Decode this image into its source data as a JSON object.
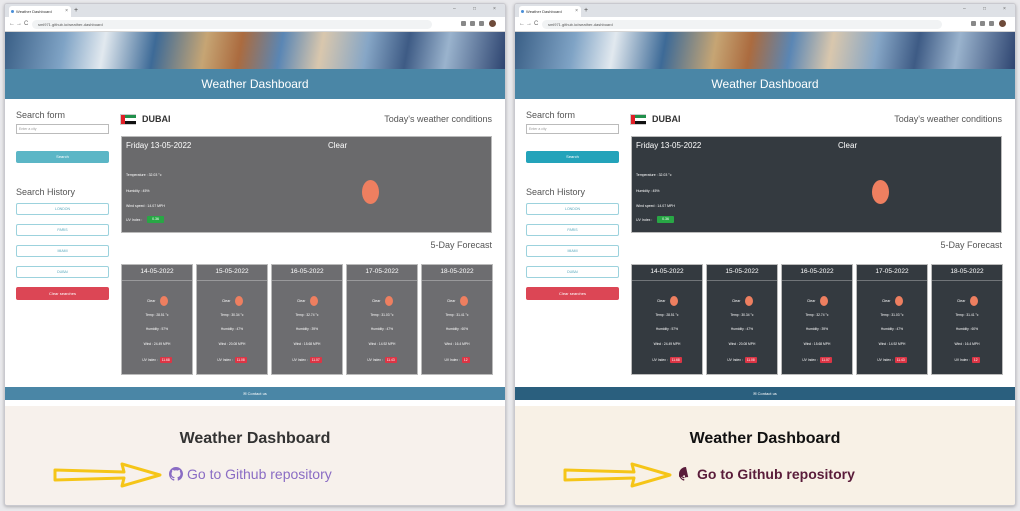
{
  "browser": {
    "tab_title": "Weather Dashboard",
    "new_tab": "+",
    "tab_close": "×",
    "url": "sml971.github.io/weather-dashboard",
    "back": "←",
    "forward": "→",
    "reload": "C",
    "window_controls": [
      "–",
      "□",
      "×"
    ]
  },
  "app": {
    "title": "Weather Dashboard",
    "search_form_title": "Search form",
    "search_placeholder": "Enter a city",
    "search_button": "Search",
    "history_title": "Search History",
    "history": [
      "LONDON",
      "PARIS",
      "MIAMI",
      "DUBAI"
    ],
    "clear_button": "Clear searches",
    "city": "DUBAI",
    "today_label": "Today's weather conditions",
    "current": {
      "date": "Friday 13-05-2022",
      "description": "Clear",
      "temperature": "Temperature : 32.03 °c",
      "humidity": "Humidity : 45%",
      "wind": "Wind speed : 14.07 MPH",
      "uv_label": "UV Index :",
      "uv_value": "0.36"
    },
    "forecast_label": "5-Day Forecast",
    "forecast": [
      {
        "date": "14-05-2022",
        "desc": "Clear",
        "temp": "Temp : 28.51 °c",
        "humidity": "Humidity : 57%",
        "wind": "Wind : 24.49 MPH",
        "uv_label": "UV Index :",
        "uv": "11.68"
      },
      {
        "date": "15-05-2022",
        "desc": "Clear",
        "temp": "Temp : 30.34 °c",
        "humidity": "Humidity : 47%",
        "wind": "Wind : 20.08 MPH",
        "uv_label": "UV Index :",
        "uv": "11.08"
      },
      {
        "date": "16-05-2022",
        "desc": "Clear",
        "temp": "Temp : 32.74 °c",
        "humidity": "Humidity : 39%",
        "wind": "Wind : 15.68 MPH",
        "uv_label": "UV Index :",
        "uv": "11.07"
      },
      {
        "date": "17-05-2022",
        "desc": "Clear",
        "temp": "Temp : 31.03 °c",
        "humidity": "Humidity : 47%",
        "wind": "Wind : 14.92 MPH",
        "uv_label": "UV Index :",
        "uv": "11.43"
      },
      {
        "date": "18-05-2022",
        "desc": "Clear",
        "temp": "Temp : 31.41 °c",
        "humidity": "Humidity : 60%",
        "wind": "Wind : 16.4 MPH",
        "uv_label": "UV Index :",
        "uv": "12"
      }
    ],
    "footer": "✉ Contact us"
  },
  "below": {
    "title": "Weather Dashboard",
    "link": "Go to Github repository"
  },
  "colors": {
    "left_accent": "#8a6cc4",
    "right_accent": "#5a1c3a",
    "arrow": "#f5c518",
    "banner": "#4a86a6"
  }
}
